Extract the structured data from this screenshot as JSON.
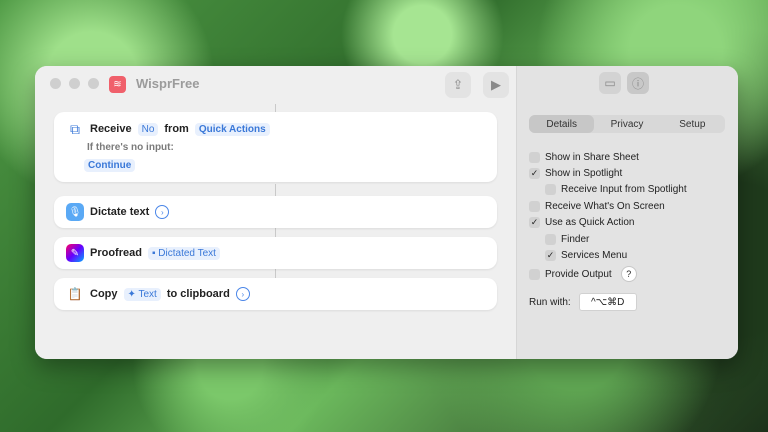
{
  "app": {
    "title": "WisprFree"
  },
  "actions": [
    {
      "verb": "Receive",
      "value": "No",
      "mid": "from",
      "source": "Quick Actions",
      "sub_label": "If there's no input:",
      "sub_chip": "Continue"
    },
    {
      "verb": "Dictate text"
    },
    {
      "verb": "Proofread",
      "chip": "Dictated Text"
    },
    {
      "verb": "Copy",
      "chip": "Text",
      "after": "to clipboard"
    }
  ],
  "inspector": {
    "tabs": [
      "Details",
      "Privacy",
      "Setup"
    ],
    "options": [
      {
        "label": "Show in Share Sheet",
        "checked": false
      },
      {
        "label": "Show in Spotlight",
        "checked": true
      },
      {
        "label": "Receive Input from Spotlight",
        "checked": false
      },
      {
        "label": "Receive What's On Screen",
        "checked": false
      },
      {
        "label": "Use as Quick Action",
        "checked": true
      },
      {
        "label": "Finder",
        "checked": false
      },
      {
        "label": "Services Menu",
        "checked": true
      },
      {
        "label": "Provide Output",
        "checked": false
      }
    ],
    "help": "?",
    "run_with_label": "Run with:",
    "shortcut": "^⌥⌘D"
  },
  "colors": {
    "accent": "#3a78d8",
    "app_icon": "#f0606b"
  }
}
